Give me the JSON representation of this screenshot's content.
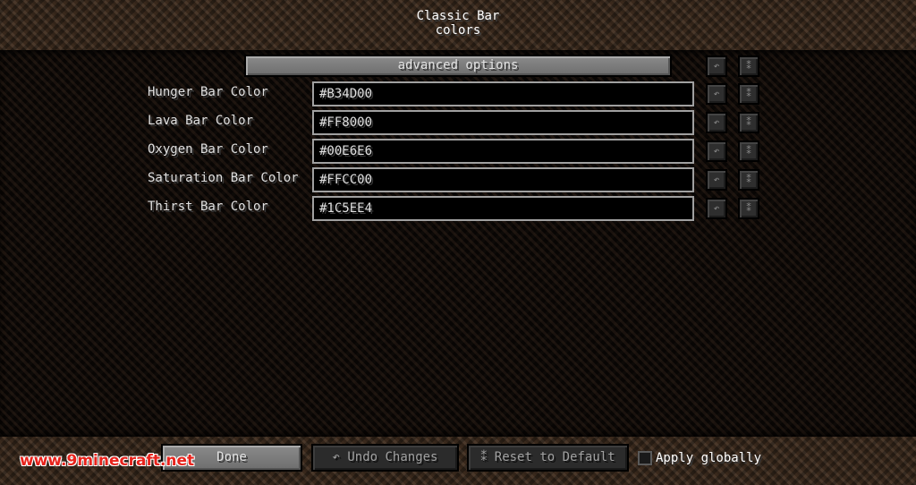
{
  "header": {
    "title_line1": "Classic Bar",
    "title_line2": "colors"
  },
  "advanced_options": {
    "label": "advanced options"
  },
  "rows": [
    {
      "label": "Hunger Bar Color",
      "value": "#B34D00"
    },
    {
      "label": "Lava Bar Color",
      "value": "#FF8000"
    },
    {
      "label": "Oxygen Bar Color",
      "value": "#00E6E6"
    },
    {
      "label": "Saturation Bar Color",
      "value": "#FFCC00"
    },
    {
      "label": "Thirst Bar Color",
      "value": "#1C5EE4"
    }
  ],
  "row_buttons": {
    "undo_glyph": "↶",
    "reset_glyph": "⁑"
  },
  "footer": {
    "done_label": "Done",
    "undo_label": "↶ Undo Changes",
    "reset_label": "⁑ Reset to Default",
    "apply_globally_label": "Apply globally"
  },
  "watermark": {
    "text": "www.9minecraft.net"
  },
  "colors": {
    "hunger": "#B34D00",
    "lava": "#FF8000",
    "oxygen": "#00E6E6",
    "saturation": "#FFCC00",
    "thirst": "#1C5EE4",
    "watermark": "#e8231c"
  }
}
